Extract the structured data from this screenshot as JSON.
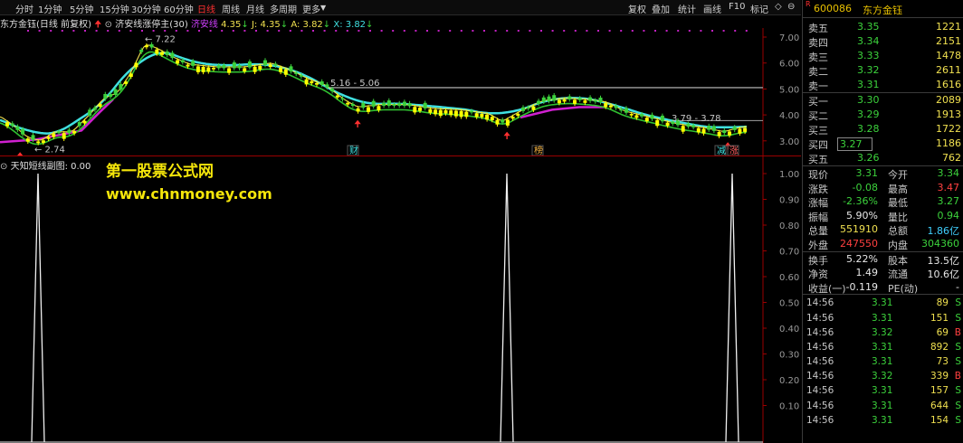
{
  "toolbar": {
    "periods": [
      "分时",
      "1分钟",
      "5分钟",
      "15分钟",
      "30分钟",
      "60分钟",
      "日线",
      "周线",
      "月线",
      "多周期",
      "更多"
    ],
    "active_period": "日线",
    "actions": [
      "复权",
      "叠加",
      "统计",
      "画线",
      "F10",
      "标记"
    ],
    "window_controls": [
      "◇",
      "⊖"
    ]
  },
  "main_chart": {
    "header_stock": "东方金钰",
    "header_mode": "(日线 前复权)",
    "indicator_name": "济安线涨停主(30)",
    "indicator_short": "济安线",
    "values_text": [
      "4.35",
      "J: 4.35",
      "A: 3.82",
      "X: 3.82"
    ],
    "y_ticks": [
      "7.00",
      "6.00",
      "5.00",
      "4.00",
      "3.00"
    ],
    "annotations": [
      "7.22",
      "2.74",
      "5.16 - 5.06",
      "3.79 - 3.78"
    ],
    "event_labels": [
      "财",
      "榜",
      "减",
      "涨"
    ],
    "colors": {
      "up_candle": "#ffff00",
      "down_candle": "#3cd23c",
      "line_cyan": "#40e0e0",
      "line_magenta": "#d020d0",
      "line_green": "#30c030",
      "line_yellow": "#f0e050",
      "dots_magenta": "#c020c0"
    }
  },
  "sub_chart": {
    "title": "天知短线副图",
    "value": ": 0.00",
    "y_ticks": [
      "1.00",
      "0.90",
      "0.80",
      "0.70",
      "0.60",
      "0.50",
      "0.40",
      "0.30",
      "0.20",
      "0.10"
    ],
    "watermark_cn": "第一股票公式网",
    "watermark_url": "www.chnmoney.com"
  },
  "quote_panel": {
    "flag": "R",
    "code": "600086",
    "name": "东方金钰",
    "asks": [
      {
        "label": "卖五",
        "price": "3.35",
        "vol": "1221"
      },
      {
        "label": "卖四",
        "price": "3.34",
        "vol": "2151"
      },
      {
        "label": "卖三",
        "price": "3.33",
        "vol": "1478"
      },
      {
        "label": "卖二",
        "price": "3.32",
        "vol": "2611"
      },
      {
        "label": "卖一",
        "price": "3.31",
        "vol": "1616"
      }
    ],
    "bids": [
      {
        "label": "买一",
        "price": "3.30",
        "vol": "2089"
      },
      {
        "label": "买二",
        "price": "3.29",
        "vol": "1913"
      },
      {
        "label": "买三",
        "price": "3.28",
        "vol": "1722"
      },
      {
        "label": "买四",
        "price": "3.27",
        "vol": "1186"
      },
      {
        "label": "买五",
        "price": "3.26",
        "vol": "762"
      }
    ],
    "stats": [
      {
        "l1": "现价",
        "v1": "3.31",
        "c1": "green",
        "l2": "今开",
        "v2": "3.34",
        "c2": "green"
      },
      {
        "l1": "涨跌",
        "v1": "-0.08",
        "c1": "green",
        "l2": "最高",
        "v2": "3.47",
        "c2": "red"
      },
      {
        "l1": "涨幅",
        "v1": "-2.36%",
        "c1": "green",
        "l2": "最低",
        "v2": "3.27",
        "c2": "green"
      },
      {
        "l1": "振幅",
        "v1": "5.90%",
        "c1": "white",
        "l2": "量比",
        "v2": "0.94",
        "c2": "green"
      },
      {
        "l1": "总量",
        "v1": "551910",
        "c1": "yellow",
        "l2": "总额",
        "v2": "1.86亿",
        "c2": "cyan"
      },
      {
        "l1": "外盘",
        "v1": "247550",
        "c1": "red",
        "l2": "内盘",
        "v2": "304360",
        "c2": "green"
      }
    ],
    "stats2": [
      {
        "l1": "换手",
        "v1": "5.22%",
        "c1": "white",
        "l2": "股本",
        "v2": "13.5亿",
        "c2": "white"
      },
      {
        "l1": "净资",
        "v1": "1.49",
        "c1": "white",
        "l2": "流通",
        "v2": "10.6亿",
        "c2": "white"
      },
      {
        "l1": "收益(一)",
        "v1": "-0.119",
        "c1": "white",
        "l2": "PE(动)",
        "v2": "-",
        "c2": "white"
      }
    ],
    "trades": [
      {
        "time": "14:56",
        "price": "3.31",
        "vol": "89",
        "bs": "S",
        "vc": "yellow",
        "pc": "green"
      },
      {
        "time": "14:56",
        "price": "3.31",
        "vol": "151",
        "bs": "S",
        "vc": "yellow",
        "pc": "green"
      },
      {
        "time": "14:56",
        "price": "3.32",
        "vol": "69",
        "bs": "B",
        "vc": "yellow",
        "pc": "green"
      },
      {
        "time": "14:56",
        "price": "3.31",
        "vol": "892",
        "bs": "S",
        "vc": "purple",
        "pc": "green"
      },
      {
        "time": "14:56",
        "price": "3.31",
        "vol": "73",
        "bs": "S",
        "vc": "yellow",
        "pc": "green"
      },
      {
        "time": "14:56",
        "price": "3.32",
        "vol": "339",
        "bs": "B",
        "vc": "yellow",
        "pc": "green"
      },
      {
        "time": "14:56",
        "price": "3.31",
        "vol": "157",
        "bs": "S",
        "vc": "yellow",
        "pc": "green"
      },
      {
        "time": "14:56",
        "price": "3.31",
        "vol": "644",
        "bs": "S",
        "vc": "purple",
        "pc": "green"
      },
      {
        "time": "14:56",
        "price": "3.31",
        "vol": "154",
        "bs": "S",
        "vc": "yellow",
        "pc": "green"
      }
    ]
  }
}
